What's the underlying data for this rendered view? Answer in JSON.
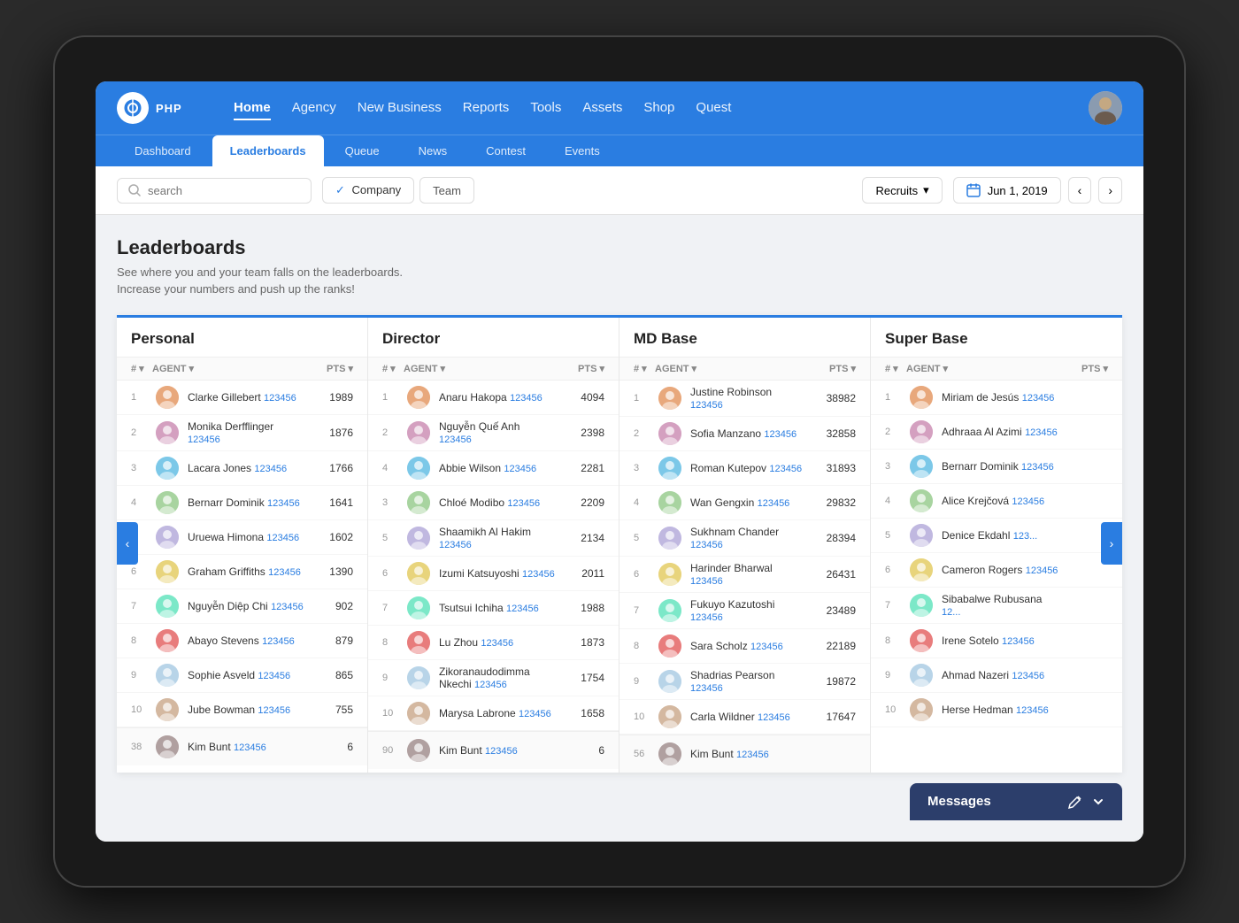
{
  "nav": {
    "logo": "PHP",
    "links": [
      "Home",
      "Agency",
      "New Business",
      "Reports",
      "Tools",
      "Assets",
      "Shop",
      "Quest"
    ],
    "active_link": "Home"
  },
  "sub_tabs": {
    "tabs": [
      "Dashboard",
      "Leaderboards",
      "Queue",
      "News",
      "Contest",
      "Events"
    ],
    "active": "Leaderboards"
  },
  "toolbar": {
    "search_placeholder": "search",
    "company_label": "Company",
    "team_label": "Team",
    "recruits_label": "Recruits",
    "date_label": "Jun 1, 2019"
  },
  "leaderboard": {
    "title": "Leaderboards",
    "description": "See where you and your team falls on the leaderboards. Increase your numbers and push up the ranks!",
    "tables": [
      {
        "title": "Personal",
        "col_rank": "#",
        "col_agent": "AGENT",
        "col_pts": "PTS",
        "rows": [
          {
            "rank": 1,
            "name": "Clarke Gillebert",
            "id": "123456",
            "pts": "1989",
            "color": "#7b8fa0"
          },
          {
            "rank": 2,
            "name": "Monika Derfflinger",
            "id": "123456",
            "pts": "1876",
            "color": "#a0867b"
          },
          {
            "rank": 3,
            "name": "Lacara Jones",
            "id": "123456",
            "pts": "1766",
            "color": "#7ba08a"
          },
          {
            "rank": 4,
            "name": "Bernarr Dominik",
            "id": "123456",
            "pts": "1641",
            "color": "#8a7ba0"
          },
          {
            "rank": 5,
            "name": "Uruewa Himona",
            "id": "123456",
            "pts": "1602",
            "color": "#a09e7b"
          },
          {
            "rank": 6,
            "name": "Graham Griffiths",
            "id": "123456",
            "pts": "1390",
            "color": "#7b9aa0"
          },
          {
            "rank": 7,
            "name": "Nguyễn Diệp Chi",
            "id": "123456",
            "pts": "902",
            "color": "#a07b7b"
          },
          {
            "rank": 8,
            "name": "Abayo Stevens",
            "id": "123456",
            "pts": "879",
            "color": "#7ba07b"
          },
          {
            "rank": 9,
            "name": "Sophie Asveld",
            "id": "123456",
            "pts": "865",
            "color": "#a0917b"
          },
          {
            "rank": 10,
            "name": "Jube Bowman",
            "id": "123456",
            "pts": "755",
            "color": "#8f7ba0"
          }
        ],
        "footer": {
          "rank": 38,
          "name": "Kim Bunt",
          "id": "123456",
          "pts": "6",
          "color": "#9a7b7b"
        }
      },
      {
        "title": "Director",
        "col_rank": "#",
        "col_agent": "AGENT",
        "col_pts": "PTS",
        "rows": [
          {
            "rank": 1,
            "name": "Anaru Hakopa",
            "id": "123456",
            "pts": "4094",
            "color": "#7b8fa0"
          },
          {
            "rank": 2,
            "name": "Nguyễn Quế Anh",
            "id": "123456",
            "pts": "2398",
            "color": "#a07b8f"
          },
          {
            "rank": 4,
            "name": "Abbie Wilson",
            "id": "123456",
            "pts": "2281",
            "color": "#7ba09a"
          },
          {
            "rank": 3,
            "name": "Chloé Modibo",
            "id": "123456",
            "pts": "2209",
            "color": "#a0987b"
          },
          {
            "rank": 5,
            "name": "Shaamikh Al Hakim",
            "id": "123456",
            "pts": "2134",
            "color": "#8a7ba0"
          },
          {
            "rank": 6,
            "name": "Izumi Katsuyoshi",
            "id": "123456",
            "pts": "2011",
            "color": "#7b9aa0"
          },
          {
            "rank": 7,
            "name": "Tsutsui Ichiha",
            "id": "123456",
            "pts": "1988",
            "color": "#a07b7b"
          },
          {
            "rank": 8,
            "name": "Lu Zhou",
            "id": "123456",
            "pts": "1873",
            "color": "#7ba07b"
          },
          {
            "rank": 9,
            "name": "Zikoranaudodimma Nkechi",
            "id": "123456",
            "pts": "1754",
            "color": "#a08f7b"
          },
          {
            "rank": 10,
            "name": "Marysa Labrone",
            "id": "123456",
            "pts": "1658",
            "color": "#7b8aa0"
          }
        ],
        "footer": {
          "rank": 90,
          "name": "Kim Bunt",
          "id": "123456",
          "pts": "6",
          "color": "#9a7b7b"
        }
      },
      {
        "title": "MD Base",
        "col_rank": "#",
        "col_agent": "AGENT",
        "col_pts": "PTS",
        "rows": [
          {
            "rank": 1,
            "name": "Justine Robinson",
            "id": "123456",
            "pts": "38982",
            "color": "#7b8fa0"
          },
          {
            "rank": 2,
            "name": "Sofia Manzano",
            "id": "123456",
            "pts": "32858",
            "color": "#a07b7b"
          },
          {
            "rank": 3,
            "name": "Roman Kutepov",
            "id": "123456",
            "pts": "31893",
            "color": "#8a7ba0"
          },
          {
            "rank": 4,
            "name": "Wan Gengxin",
            "id": "123456",
            "pts": "29832",
            "color": "#7ba07b"
          },
          {
            "rank": 5,
            "name": "Sukhnam Chander",
            "id": "123456",
            "pts": "28394",
            "color": "#a09e7b"
          },
          {
            "rank": 6,
            "name": "Harinder Bharwal",
            "id": "123456",
            "pts": "26431",
            "color": "#7b9aa0"
          },
          {
            "rank": 7,
            "name": "Fukuyo Kazutoshi",
            "id": "123456",
            "pts": "23489",
            "color": "#a07b8f"
          },
          {
            "rank": 8,
            "name": "Sara Scholz",
            "id": "123456",
            "pts": "22189",
            "color": "#7ba09a"
          },
          {
            "rank": 9,
            "name": "Shadrias Pearson",
            "id": "123456",
            "pts": "19872",
            "color": "#a0917b"
          },
          {
            "rank": 10,
            "name": "Carla Wildner",
            "id": "123456",
            "pts": "17647",
            "color": "#8f7ba0"
          }
        ],
        "footer": {
          "rank": 56,
          "name": "Kim Bunt",
          "id": "123456",
          "pts": "",
          "color": "#9a7b7b"
        }
      },
      {
        "title": "Super Base",
        "col_rank": "#",
        "col_agent": "AGENT",
        "col_pts": "PTS",
        "rows": [
          {
            "rank": 1,
            "name": "Miriam de Jesús",
            "id": "123456",
            "pts": "",
            "color": "#7b8fa0"
          },
          {
            "rank": 2,
            "name": "Adhraaa Al Azimi",
            "id": "123456",
            "pts": "",
            "color": "#a07b7b"
          },
          {
            "rank": 3,
            "name": "Bernarr Dominik",
            "id": "123456",
            "pts": "",
            "color": "#8a7ba0"
          },
          {
            "rank": 4,
            "name": "Alice Krejčová",
            "id": "123456",
            "pts": "",
            "color": "#7ba07b"
          },
          {
            "rank": 5,
            "name": "Denice Ekdahl",
            "id": "123...",
            "pts": "",
            "color": "#a09e7b"
          },
          {
            "rank": 6,
            "name": "Cameron Rogers",
            "id": "123456",
            "pts": "",
            "color": "#7b9aa0"
          },
          {
            "rank": 7,
            "name": "Sibabalwe Rubusana",
            "id": "12...",
            "pts": "",
            "color": "#a07b8f"
          },
          {
            "rank": 8,
            "name": "Irene Sotelo",
            "id": "123456",
            "pts": "",
            "color": "#7ba09a"
          },
          {
            "rank": 9,
            "name": "Ahmad Nazeri",
            "id": "123456",
            "pts": "",
            "color": "#a0917b"
          },
          {
            "rank": 10,
            "name": "Herse Hedman",
            "id": "123456",
            "pts": "",
            "color": "#8f7ba0"
          }
        ],
        "footer": null
      }
    ]
  },
  "messages": {
    "label": "Messages"
  }
}
